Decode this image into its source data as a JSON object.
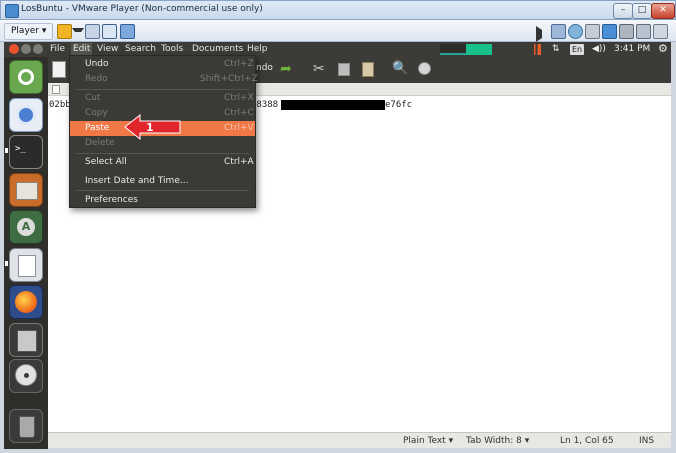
{
  "window": {
    "title": "LosBuntu - VMware Player (Non-commercial use only)"
  },
  "vm_toolbar": {
    "player_label": "Player ▾"
  },
  "menubar": {
    "items": [
      "File",
      "Edit",
      "View",
      "Search",
      "Tools",
      "Documents",
      "Help"
    ]
  },
  "panel": {
    "keyboard": "En",
    "time": "3:41 PM"
  },
  "gedit_toolbar": {
    "undo_label": "ndo"
  },
  "editor": {
    "line_prefix": "02bb",
    "mid_fragment": "88388",
    "line_suffix": "e76fc"
  },
  "edit_menu": {
    "items": [
      {
        "label": "Undo",
        "shortcut": "Ctrl+Z",
        "enabled": true
      },
      {
        "label": "Redo",
        "shortcut": "Shift+Ctrl+Z",
        "enabled": false
      },
      {
        "label": "Cut",
        "shortcut": "Ctrl+X",
        "enabled": false
      },
      {
        "label": "Copy",
        "shortcut": "Ctrl+C",
        "enabled": false
      },
      {
        "label": "Paste",
        "shortcut": "Ctrl+V",
        "enabled": true,
        "highlighted": true
      },
      {
        "label": "Delete",
        "shortcut": "",
        "enabled": false
      },
      {
        "label": "Select All",
        "shortcut": "Ctrl+A",
        "enabled": true
      },
      {
        "label": "Insert Date and Time...",
        "shortcut": "",
        "enabled": true
      },
      {
        "label": "Preferences",
        "shortcut": "",
        "enabled": true
      }
    ]
  },
  "annotation": {
    "number": "1",
    "color": "#e0262c"
  },
  "statusbar": {
    "syntax": "Plain Text ▾",
    "tab_width": "Tab Width: 8 ▾",
    "position": "Ln 1, Col 65",
    "mode": "INS"
  },
  "colors": {
    "ubuntu_panel": "#3c3b37",
    "menu_bg": "#3b3a36",
    "highlight": "#f07746",
    "launcher": "#2f2e2a"
  }
}
